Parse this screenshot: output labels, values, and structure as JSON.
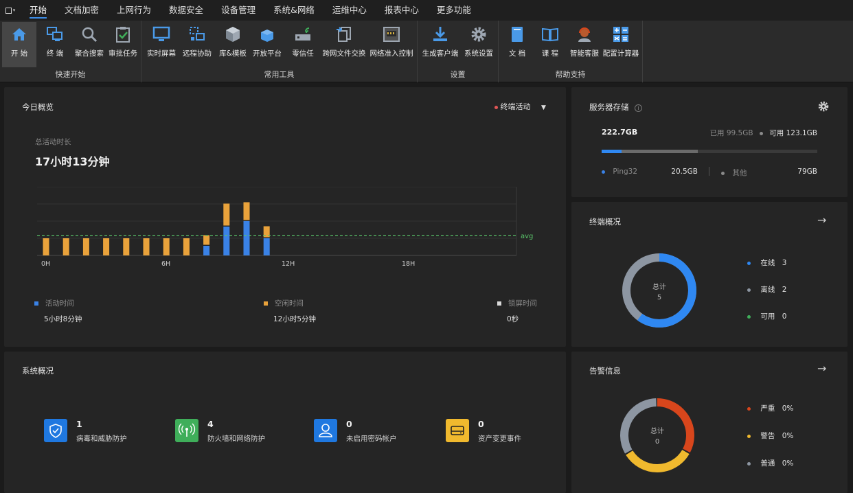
{
  "menubar": {
    "items": [
      "开始",
      "文档加密",
      "上网行为",
      "数据安全",
      "设备管理",
      "系统&网络",
      "运维中心",
      "报表中心",
      "更多功能"
    ]
  },
  "ribbon": {
    "groups": [
      {
        "label": "快速开始",
        "buttons": [
          "开 始",
          "终 端",
          "聚合搜索",
          "审批任务"
        ]
      },
      {
        "label": "常用工具",
        "buttons": [
          "实时屏幕",
          "远程协助",
          "库&模板",
          "开放平台",
          "零信任",
          "跨网文件交换",
          "网络准入控制"
        ]
      },
      {
        "label": "设置",
        "buttons": [
          "生成客户端",
          "系统设置"
        ]
      },
      {
        "label": "帮助支持",
        "buttons": [
          "文 档",
          "课 程",
          "智能客服",
          "配置计算器"
        ]
      }
    ]
  },
  "overview": {
    "title": "今日概览",
    "filter_label": "终端活动",
    "total_label": "总活动时长",
    "total_value": "17小时13分钟",
    "avg_label": "avg",
    "legend": [
      {
        "name": "活动时间",
        "value": "5小时8分钟",
        "color": "#3a82e6"
      },
      {
        "name": "空闲时间",
        "value": "12小时5分钟",
        "color": "#e9a23b"
      },
      {
        "name": "锁屏时间",
        "value": "0秒",
        "color": "#d8d8d8"
      }
    ]
  },
  "chart_data": {
    "type": "bar",
    "stacked": true,
    "x_tick_labels": [
      "0H",
      "6H",
      "12H",
      "18H"
    ],
    "x": [
      0,
      1,
      2,
      3,
      4,
      5,
      6,
      7,
      8,
      9,
      10,
      11
    ],
    "series": [
      {
        "name": "活动时间",
        "color": "#3a82e6",
        "values": [
          0,
          0,
          0,
          0,
          0,
          0,
          0,
          0,
          14,
          42,
          50,
          25
        ]
      },
      {
        "name": "空闲时间",
        "color": "#e9a23b",
        "values": [
          25,
          25,
          25,
          25,
          25,
          25,
          25,
          25,
          14,
          32,
          26,
          16
        ]
      }
    ],
    "avg": 29,
    "ylim": [
      0,
      100
    ],
    "grid": true
  },
  "storage": {
    "title": "服务器存储",
    "total": "222.7GB",
    "used_label": "已用",
    "used_value": "99.5GB",
    "avail_label": "可用",
    "avail_value": "123.1GB",
    "ping_fraction": 0.092,
    "used_fraction": 0.447,
    "items": [
      {
        "name": "Ping32",
        "value": "20.5GB",
        "color": "#3a82e6"
      },
      {
        "name": "其他",
        "value": "79GB",
        "color": "#8a8a8a"
      }
    ]
  },
  "terminals": {
    "title": "终端概况",
    "center_label": "总计",
    "center_value": "5",
    "items": [
      {
        "name": "在线",
        "value": "3",
        "color": "#2f88f2"
      },
      {
        "name": "离线",
        "value": "2",
        "color": "#8d96a2"
      },
      {
        "name": "可用",
        "value": "0",
        "color": "#3fae5a"
      }
    ]
  },
  "system": {
    "title": "系统概况",
    "cards": [
      {
        "count": "1",
        "label": "病毒和威胁防护",
        "color": "#1f78e0",
        "icon": "shield-icon"
      },
      {
        "count": "4",
        "label": "防火墙和网络防护",
        "color": "#3fae5a",
        "icon": "antenna-icon"
      },
      {
        "count": "0",
        "label": "未启用密码帐户",
        "color": "#1f78e0",
        "icon": "user-icon"
      },
      {
        "count": "0",
        "label": "资产变更事件",
        "color": "#f0b92e",
        "icon": "drive-icon"
      }
    ]
  },
  "alerts": {
    "title": "告警信息",
    "center_label": "总计",
    "center_value": "0",
    "items": [
      {
        "name": "严重",
        "value": "0%",
        "color": "#d8461c"
      },
      {
        "name": "警告",
        "value": "0%",
        "color": "#f0b92e"
      },
      {
        "name": "普通",
        "value": "0%",
        "color": "#8d96a2"
      }
    ]
  }
}
